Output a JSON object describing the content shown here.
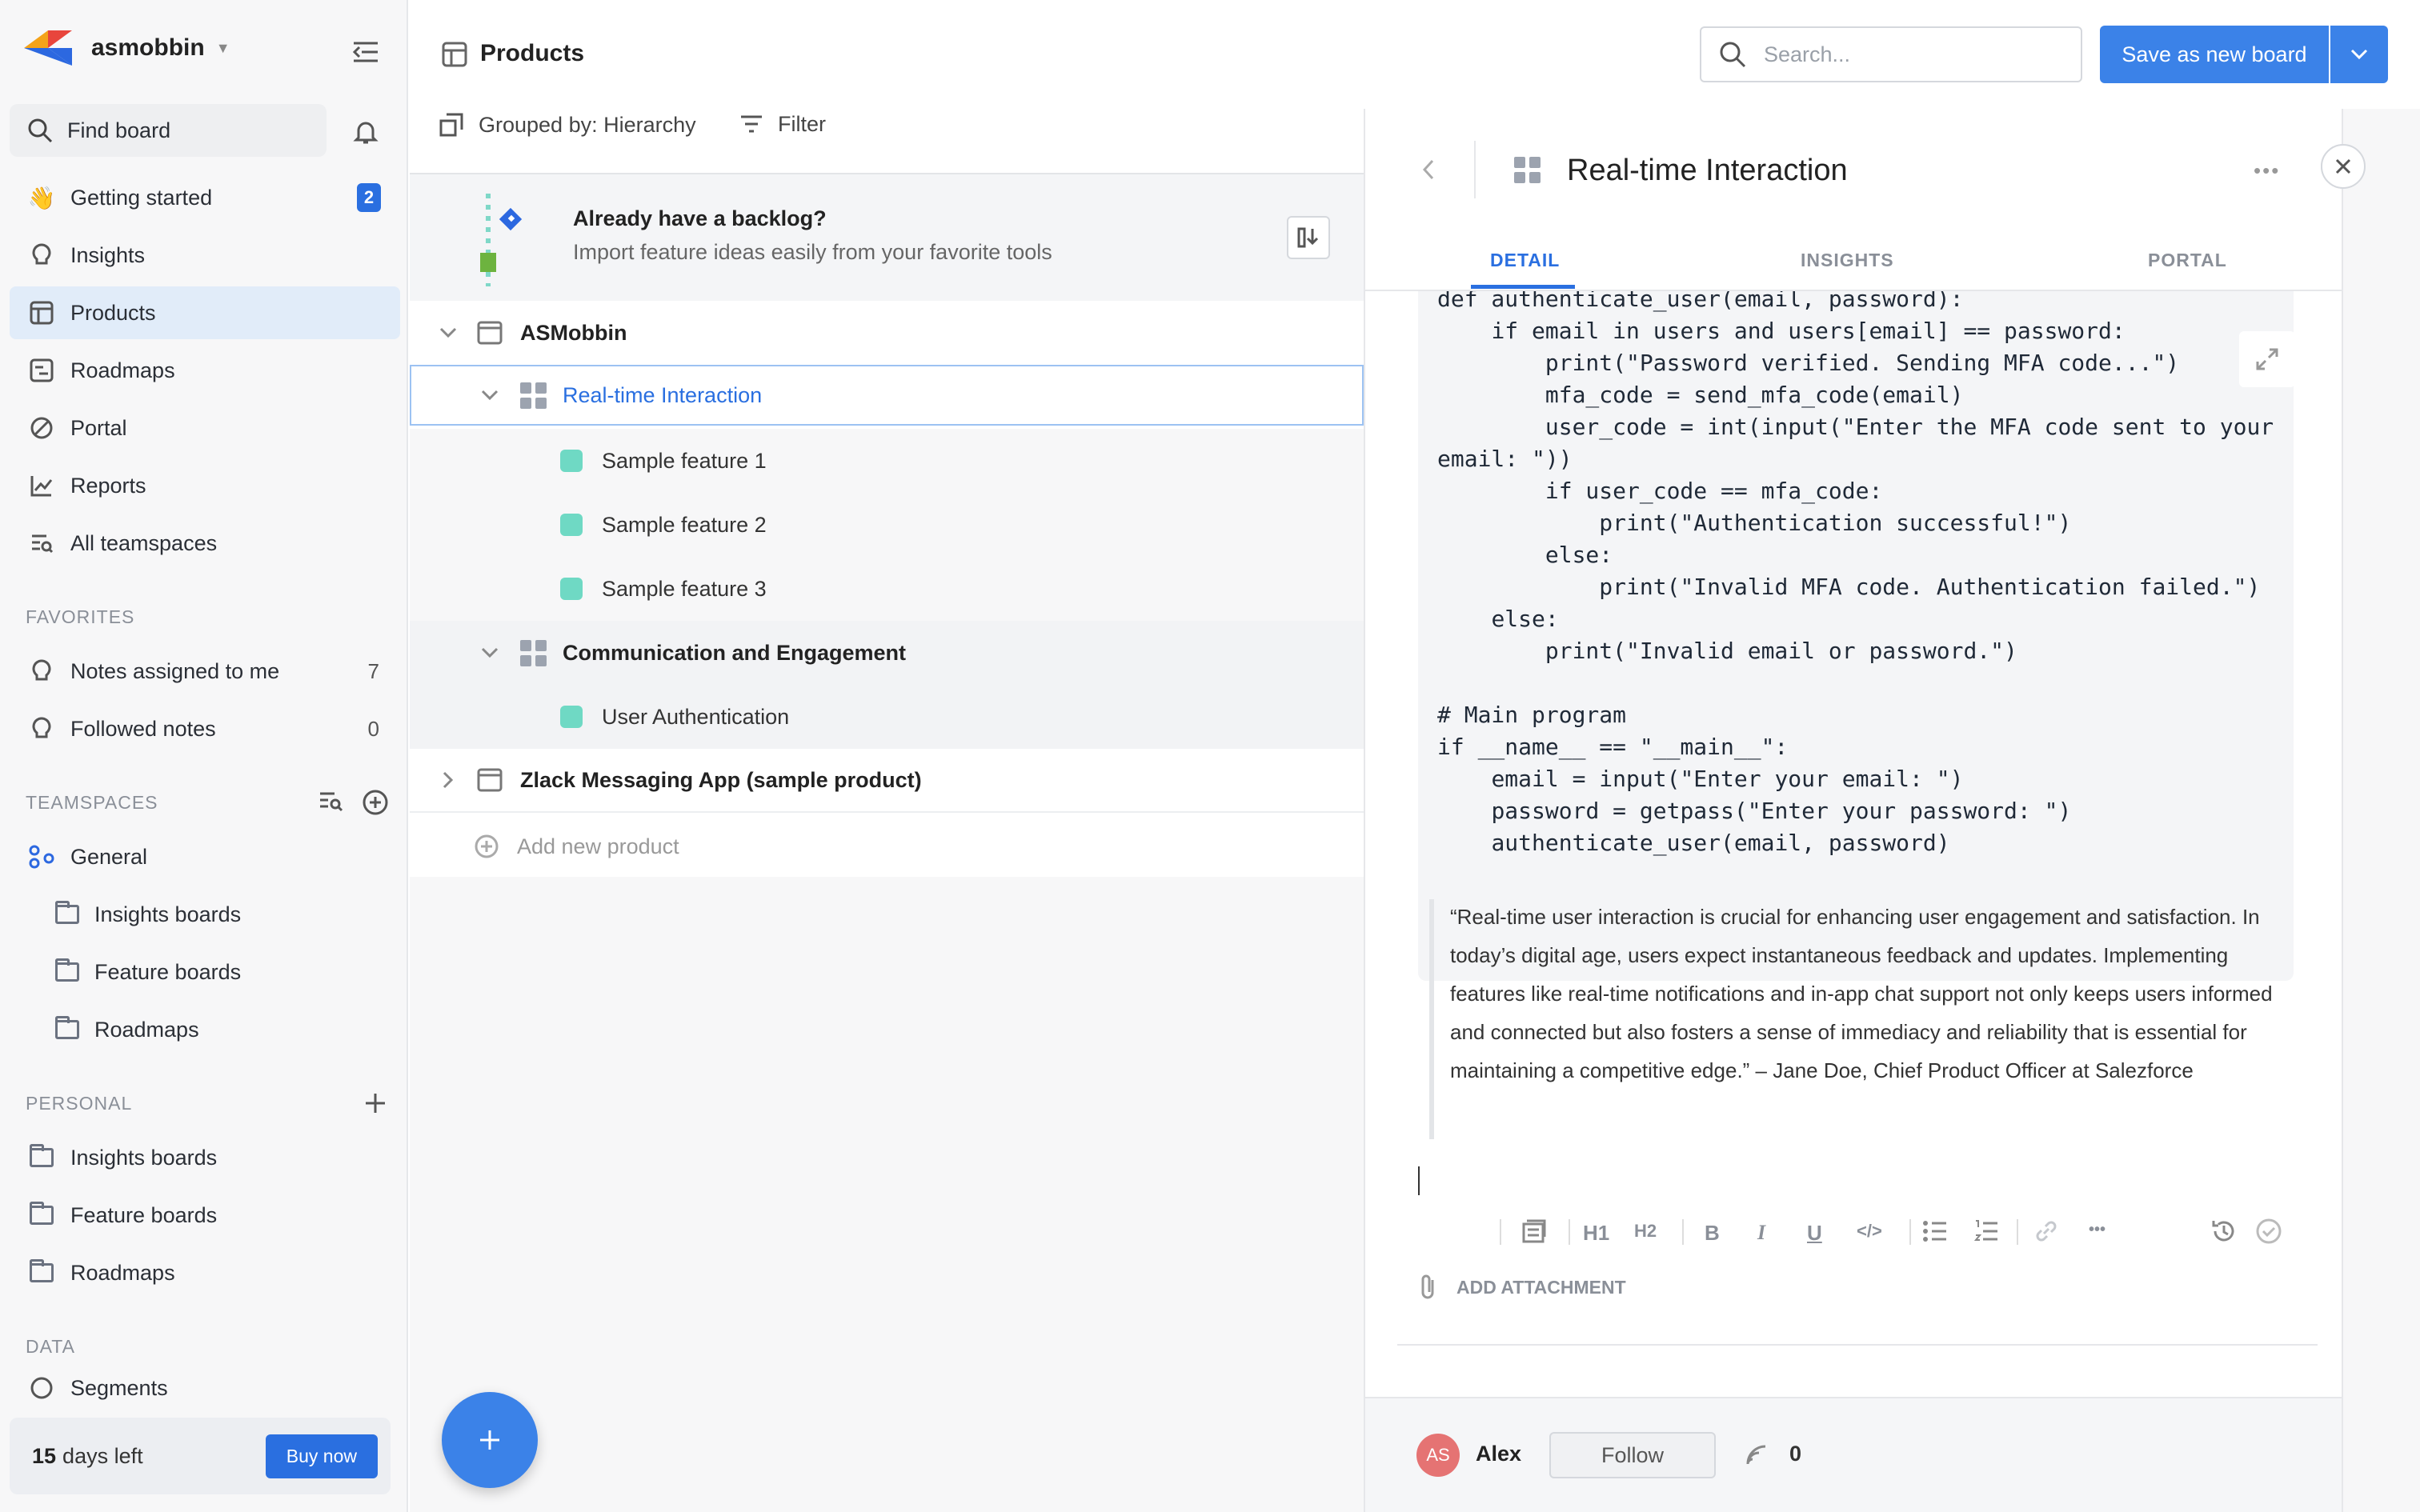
{
  "workspace": {
    "name": "asmobbin"
  },
  "sidebar": {
    "find_board": "Find board",
    "nav": [
      {
        "label": "Getting started",
        "badge": "2"
      },
      {
        "label": "Insights"
      },
      {
        "label": "Products"
      },
      {
        "label": "Roadmaps"
      },
      {
        "label": "Portal"
      },
      {
        "label": "Reports"
      },
      {
        "label": "All teamspaces"
      }
    ],
    "favorites_title": "FAVORITES",
    "favorites": [
      {
        "label": "Notes assigned to me",
        "count": "7"
      },
      {
        "label": "Followed notes",
        "count": "0"
      }
    ],
    "teamspaces_title": "TEAMSPACES",
    "teamspace": "General",
    "teamspace_items": [
      "Insights boards",
      "Feature boards",
      "Roadmaps"
    ],
    "personal_title": "PERSONAL",
    "personal_items": [
      "Insights boards",
      "Feature boards",
      "Roadmaps"
    ],
    "data_title": "DATA",
    "data_items": [
      "Segments"
    ],
    "trial": {
      "days": "15",
      "days_suffix": "days left",
      "buy": "Buy now"
    }
  },
  "header": {
    "title": "Products",
    "search_placeholder": "Search...",
    "save_button": "Save as new board",
    "grouped_by": "Grouped by: Hierarchy",
    "filter": "Filter"
  },
  "banner": {
    "title": "Already have a backlog?",
    "subtitle": "Import feature ideas easily from your favorite tools"
  },
  "tree": {
    "product1": "ASMobbin",
    "component1": "Real-time Interaction",
    "features1": [
      "Sample feature 1",
      "Sample feature 2",
      "Sample feature 3"
    ],
    "component2": "Communication and Engagement",
    "features2": [
      "User Authentication"
    ],
    "product2": "Zlack Messaging App (sample product)",
    "add_product": "Add new product"
  },
  "detail": {
    "title": "Real-time Interaction",
    "tabs": [
      "DETAIL",
      "INSIGHTS",
      "PORTAL"
    ],
    "code": "def authenticate_user(email, password):\n    if email in users and users[email] == password:\n        print(\"Password verified. Sending MFA code...\")\n        mfa_code = send_mfa_code(email)\n        user_code = int(input(\"Enter the MFA code sent to your email: \"))\n        if user_code == mfa_code:\n            print(\"Authentication successful!\")\n        else:\n            print(\"Invalid MFA code. Authentication failed.\")\n    else:\n        print(\"Invalid email or password.\")\n\n# Main program\nif __name__ == \"__main__\":\n    email = input(\"Enter your email: \")\n    password = getpass(\"Enter your password: \")\n    authenticate_user(email, password)",
    "quote": "“Real-time user interaction is crucial for enhancing user engagement and satisfaction. In today’s digital age, users expect instantaneous feedback and updates. Implementing features like real-time notifications and in-app chat support not only keeps users informed and connected but also fosters a sense of immediacy and reliability that is essential for maintaining a competitive edge.” – Jane Doe, Chief Product Officer at Salezforce",
    "toolbar": {
      "h1": "H1",
      "h2": "H2",
      "bold": "B",
      "italic": "I",
      "underline": "U",
      "code": "</>",
      "more": "•••"
    },
    "add_attachment": "ADD ATTACHMENT",
    "owner": {
      "initials": "AS",
      "name": "Alex"
    },
    "follow": "Follow",
    "followers": "0"
  },
  "colors": {
    "accent": "#3b82e8",
    "feature": "#6fd9c4",
    "active_nav": "#e1ecf9"
  }
}
